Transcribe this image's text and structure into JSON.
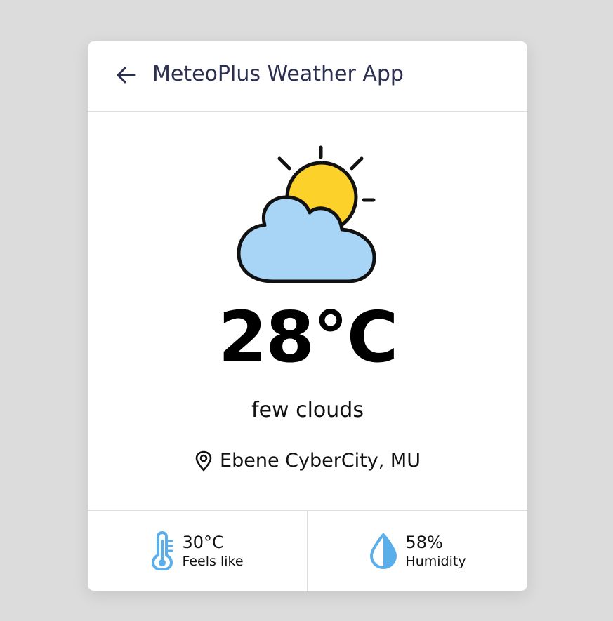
{
  "header": {
    "back_icon": "arrow-left-icon",
    "title": "MeteoPlus Weather App"
  },
  "weather": {
    "icon": "partly-cloudy-icon",
    "temperature": "28°C",
    "description": "few clouds",
    "location_icon": "map-pin-icon",
    "location": "Ebene CyberCity, MU"
  },
  "stats": {
    "feels_like": {
      "icon": "thermometer-icon",
      "value": "30°C",
      "label": "Feels like"
    },
    "humidity": {
      "icon": "water-drop-icon",
      "value": "58%",
      "label": "Humidity"
    }
  },
  "colors": {
    "background": "#dcdcdc",
    "card": "#ffffff",
    "title": "#2b3050",
    "sun": "#fcd12a",
    "cloud": "#a8d4f5",
    "stat_icon": "#5aaeea"
  }
}
